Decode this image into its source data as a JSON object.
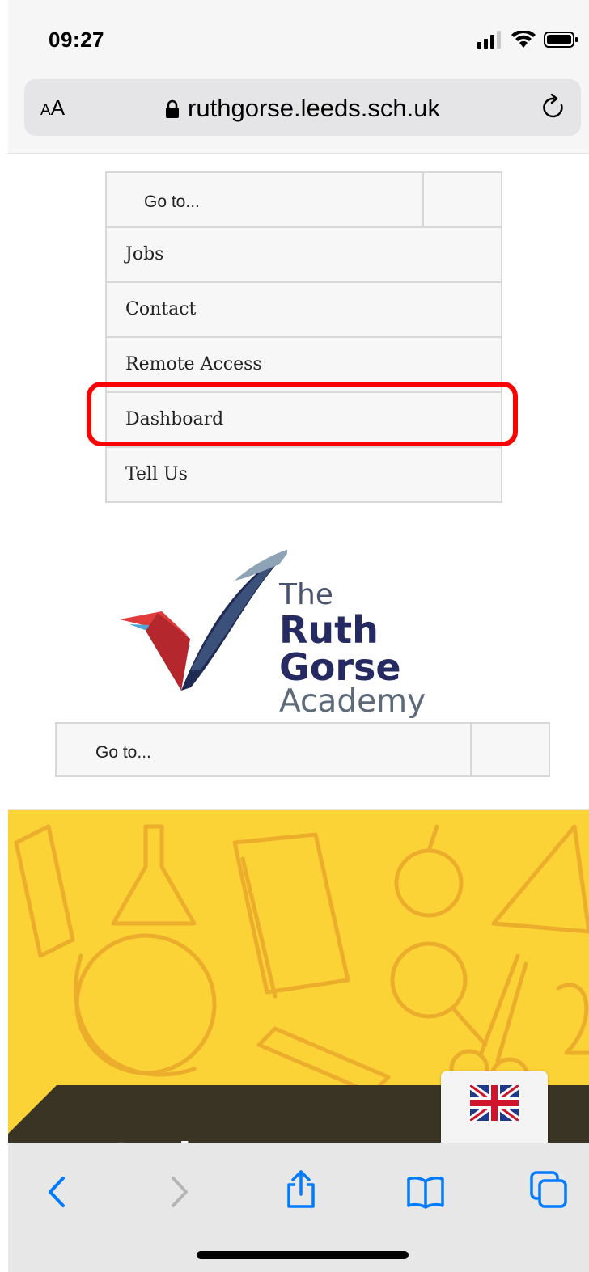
{
  "status_bar": {
    "time": "09:27"
  },
  "address_bar": {
    "text_size_label": "AA",
    "url": "ruthgorse.leeds.sch.uk"
  },
  "top_menu": {
    "goto_label": "Go to...",
    "items": [
      {
        "label": "Jobs"
      },
      {
        "label": "Contact"
      },
      {
        "label": "Remote Access"
      },
      {
        "label": "Dashboard",
        "highlighted": true
      },
      {
        "label": "Tell Us"
      }
    ]
  },
  "logo": {
    "line1": "The",
    "line2": "Ruth Gorse",
    "line3": "Academy"
  },
  "second_menu": {
    "goto_label": "Go to..."
  },
  "hero": {
    "heading_partial": "Sa     l  I"
  },
  "language": {
    "flag_icon": "uk-flag-icon"
  },
  "colors": {
    "accent_blue": "#007aff",
    "highlight_red": "#ff0000",
    "hero_yellow": "#fbd336",
    "logo_navy": "#252a63"
  }
}
